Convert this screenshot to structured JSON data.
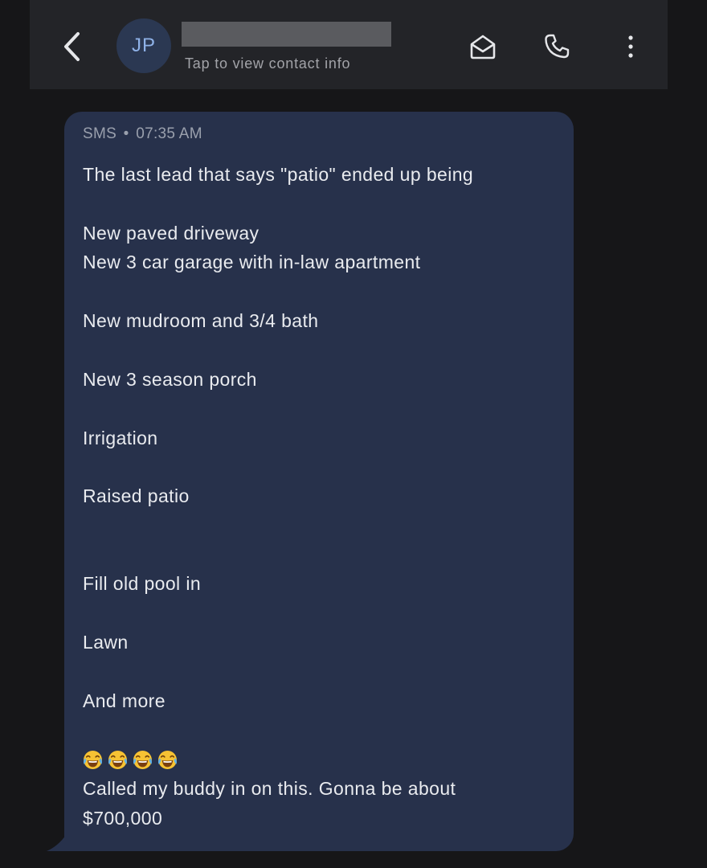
{
  "header": {
    "avatar_initials": "JP",
    "contact_subtitle": "Tap to view contact info",
    "contact_name_redacted": true,
    "icons": {
      "back": "chevron-left-icon",
      "mark_unread": "open-envelope-icon",
      "call": "phone-icon",
      "more": "more-vertical-icon"
    }
  },
  "message": {
    "channel": "SMS",
    "separator": "•",
    "time": "07:35 AM",
    "lines": {
      "l1": "The last lead that says \"patio\" ended up being",
      "l2": "New paved driveway",
      "l3": "New 3 car garage with in-law apartment",
      "l4": "New mudroom and 3/4 bath",
      "l5": "New 3 season porch",
      "l6": "Irrigation",
      "l7": "Raised patio",
      "l8": "Fill old pool in",
      "l9": "Lawn",
      "l10": "And more",
      "l11": "Called my buddy in on this. Gonna be about",
      "l12": "$700,000"
    },
    "emojis": [
      "face-with-tears-of-joy",
      "face-with-tears-of-joy",
      "face-with-tears-of-joy",
      "face-with-tears-of-joy"
    ]
  },
  "colors": {
    "background": "#161618",
    "header": "#232428",
    "bubble": "#27314b",
    "avatar_bg": "#2b3852",
    "avatar_text": "#8fb2e8",
    "message_text": "#e9ebef",
    "meta_text": "#9aa0ad"
  }
}
